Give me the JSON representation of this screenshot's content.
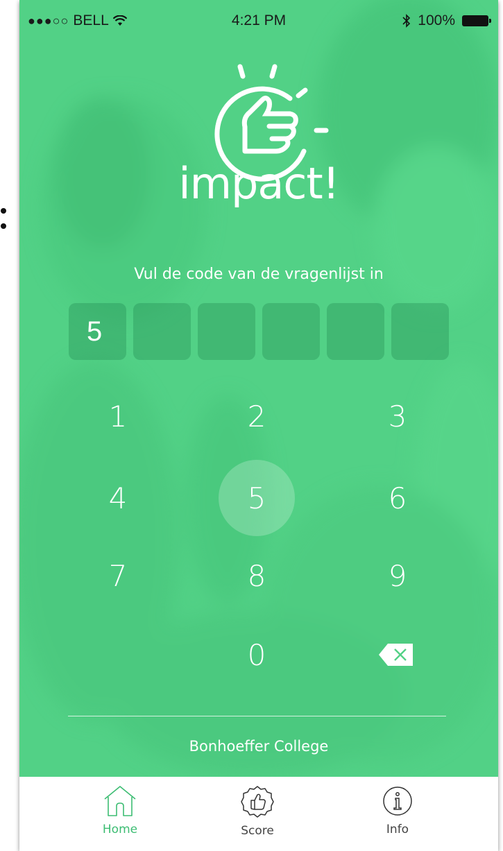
{
  "status_bar": {
    "signal": "●●●○○",
    "carrier": "BELL",
    "wifi_icon": "wifi-icon",
    "time": "4:21 PM",
    "bluetooth_icon": "bluetooth-icon",
    "battery": "100%"
  },
  "app": {
    "brand": "impact!",
    "prompt": "Vul de code van de vragenlijst in",
    "code_digits": [
      "5",
      "",
      "",
      "",
      "",
      ""
    ],
    "school": "Bonhoeffer College",
    "accent_color": "#52d186",
    "tab_active_color": "#3dbd73"
  },
  "keypad": {
    "keys": [
      "1",
      "2",
      "3",
      "4",
      "5",
      "6",
      "7",
      "8",
      "9",
      "0"
    ],
    "pressed_key": "5",
    "backspace_icon": "backspace-icon"
  },
  "tabs": [
    {
      "label": "Home",
      "icon": "home-icon",
      "active": true
    },
    {
      "label": "Score",
      "icon": "thumbs-up-badge-icon",
      "active": false
    },
    {
      "label": "Info",
      "icon": "info-icon",
      "active": false
    }
  ]
}
